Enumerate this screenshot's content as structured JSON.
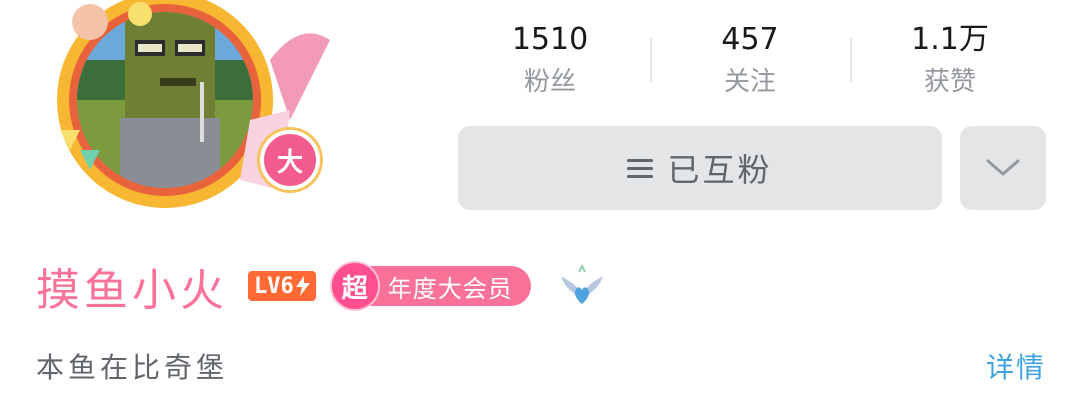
{
  "profile": {
    "level_badge_char": "大",
    "username": "摸鱼小火",
    "level_label": "LV6",
    "vip_super_char": "超",
    "vip_label": "年度大会员",
    "signature": "本鱼在比奇堡",
    "detail_link": "详情"
  },
  "stats": [
    {
      "value": "1510",
      "label": "粉丝"
    },
    {
      "value": "457",
      "label": "关注"
    },
    {
      "value": "1.1万",
      "label": "获赞"
    }
  ],
  "actions": {
    "follow_label": "已互粉"
  },
  "colors": {
    "accent_pink": "#fb7299",
    "link_blue": "#3ea3e0",
    "button_gray": "#e3e5e7",
    "level_orange": "#ff6933"
  },
  "icons": {
    "menu": "menu-lines-icon",
    "more": "chevron-down-icon",
    "pendant": "heart-wings-icon"
  }
}
